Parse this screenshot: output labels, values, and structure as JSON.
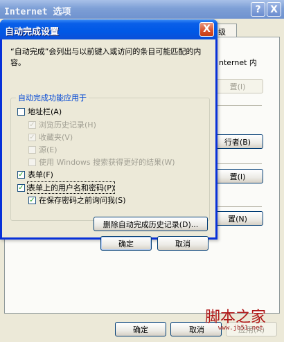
{
  "background_window": {
    "title": "Internet 选项",
    "help_btn": "?",
    "close_btn": "X",
    "tab_partial": "级",
    "text_partial": "nternet 内",
    "btn1": "置(I)",
    "btn2": "行者(B)",
    "btn3": "置(I)",
    "btn4": "置(N)",
    "ok_label": "确定",
    "cancel_label": "取消",
    "apply_label": "应用(A)"
  },
  "dialog": {
    "title": "自动完成设置",
    "close_btn": "X",
    "description": "“自动完成”会列出与以前键入或访问的条目可能匹配的内容。",
    "group_label": "自动完成功能应用于",
    "options": [
      {
        "label": "地址栏(A)",
        "checked": false,
        "disabled": false
      },
      {
        "label": "浏览历史记录(H)",
        "checked": true,
        "disabled": true
      },
      {
        "label": "收藏夹(V)",
        "checked": true,
        "disabled": true
      },
      {
        "label": "源(E)",
        "checked": false,
        "disabled": true
      },
      {
        "label": "使用 Windows 搜索获得更好的结果(W)",
        "checked": false,
        "disabled": true
      },
      {
        "label": "表单(F)",
        "checked": true,
        "disabled": false
      },
      {
        "label": "表单上的用户名和密码(P)",
        "checked": true,
        "disabled": false
      },
      {
        "label": "在保存密码之前询问我(S)",
        "checked": true,
        "disabled": false
      }
    ],
    "delete_history_label": "删除自动完成历史记录(D)...",
    "ok_label": "确定",
    "cancel_label": "取消"
  },
  "watermark": {
    "text": "脚本之家",
    "url": "www.jb51.net"
  }
}
